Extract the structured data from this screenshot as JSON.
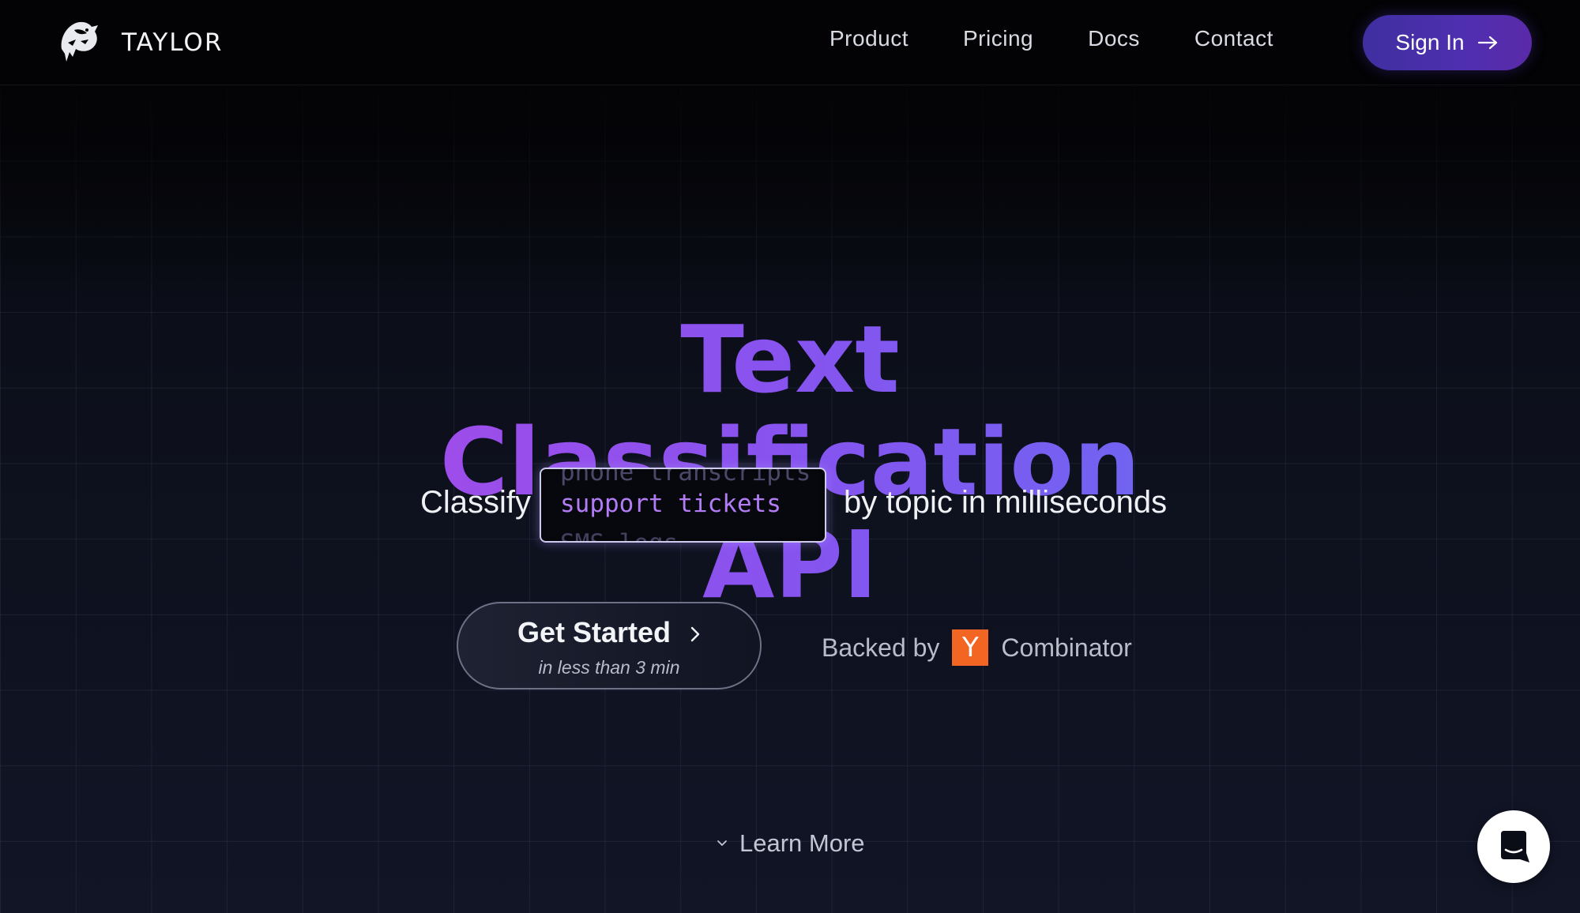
{
  "header": {
    "brand_name": "TAYLOR",
    "nav": [
      {
        "label": "Product"
      },
      {
        "label": "Pricing"
      },
      {
        "label": "Docs"
      },
      {
        "label": "Contact"
      }
    ],
    "signin_label": "Sign In",
    "signin_icon": "arrow-right-icon"
  },
  "hero": {
    "title": "Text Classification API",
    "classify_prefix": "Classify",
    "ticker": {
      "previous": "phone transcripts",
      "current": "support tickets",
      "next": "SMS logs"
    },
    "classify_suffix": "by topic in milliseconds",
    "cta": {
      "label": "Get Started",
      "sublabel": "in less than 3 min",
      "icon": "chevron-right-icon"
    },
    "backed": {
      "prefix": "Backed by",
      "logo_letter": "Y",
      "name": "Combinator"
    },
    "learn_more": "Learn More"
  },
  "colors": {
    "background": "#0b0d16",
    "accent_start": "#a34be8",
    "accent_end": "#6b68f2",
    "signin_button": "#4f2fb0",
    "yc_orange": "#f26522"
  },
  "icons": {
    "logo": "orca-logo-icon",
    "learn_more": "chevron-down-icon",
    "chat": "chat-bubble-icon"
  }
}
